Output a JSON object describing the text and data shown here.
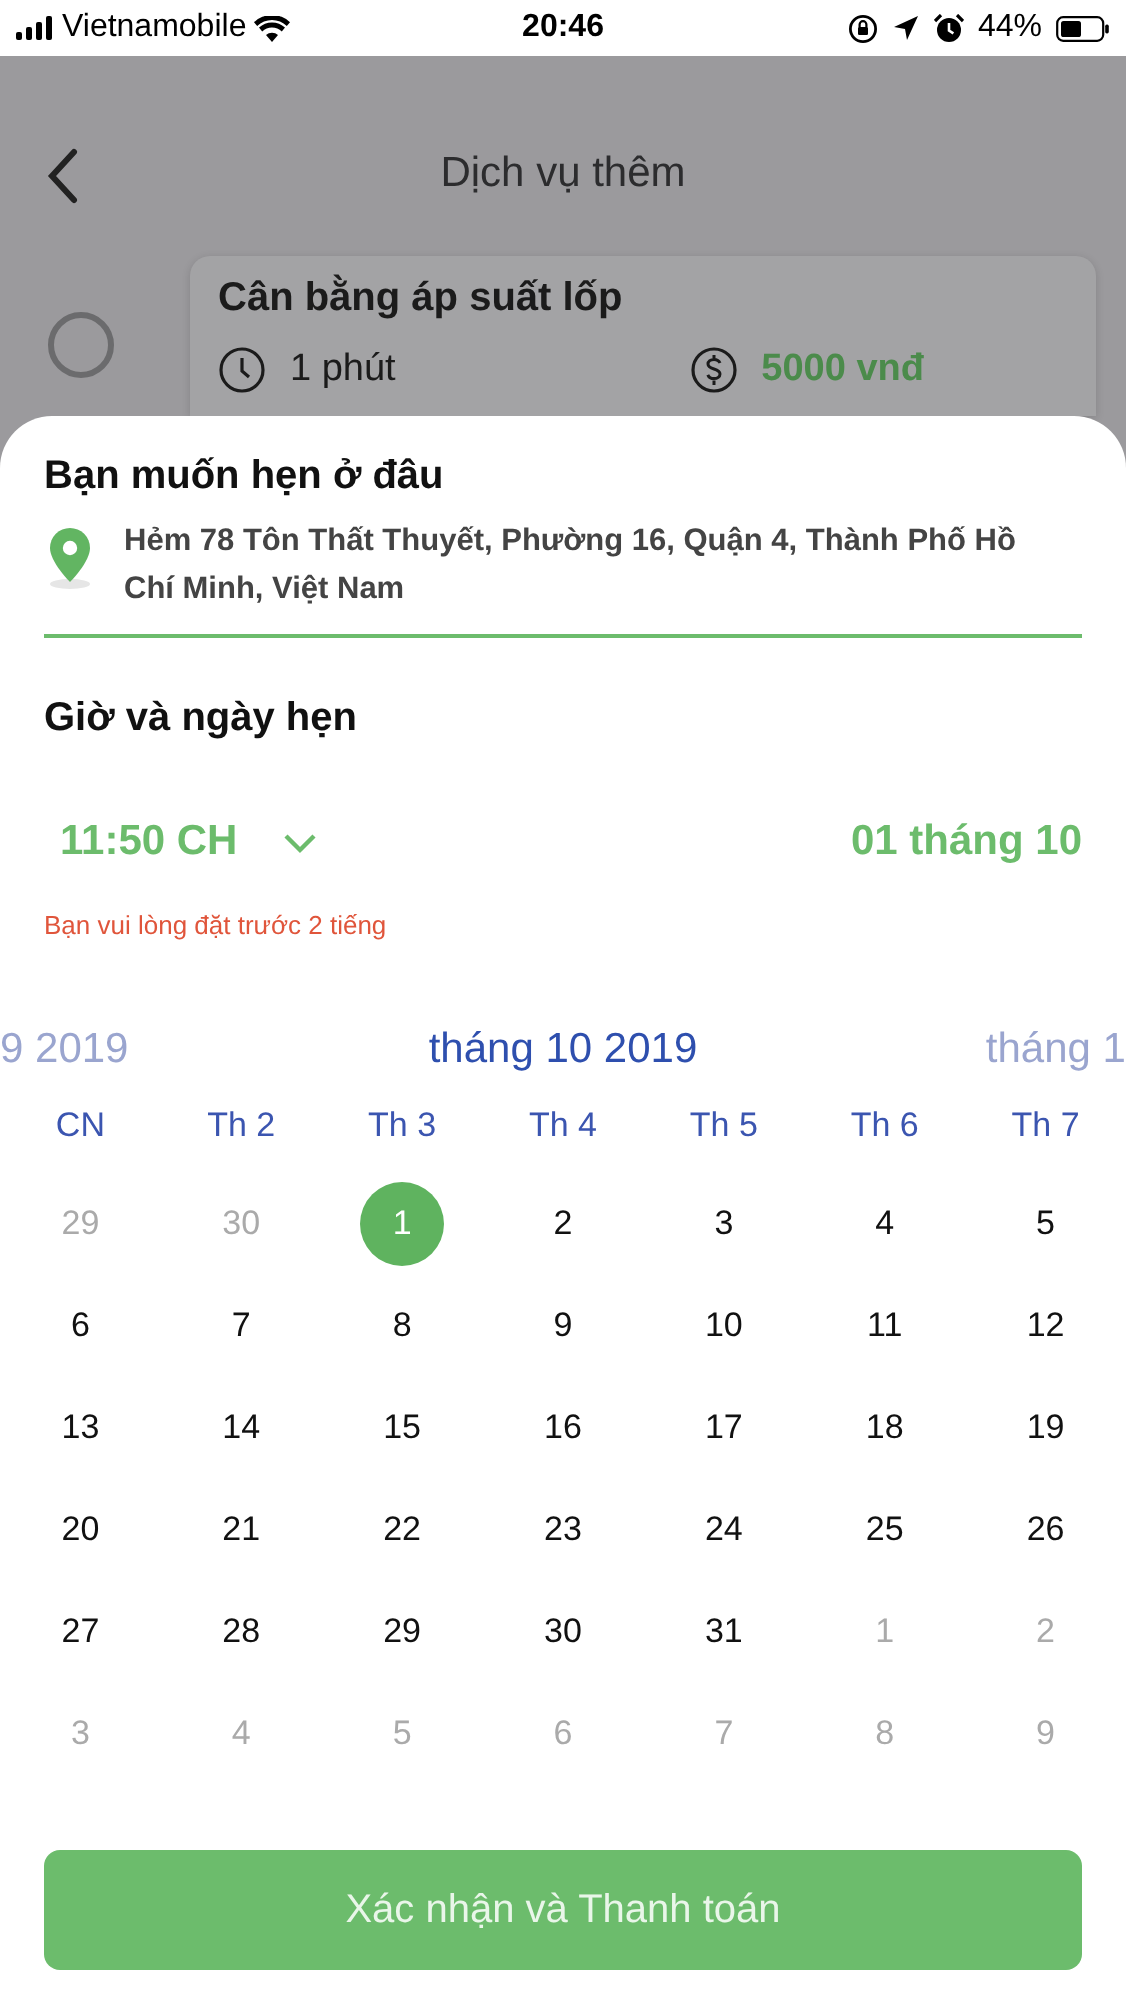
{
  "status_bar": {
    "carrier": "Vietnamobile",
    "time": "20:46",
    "battery": "44%"
  },
  "background_screen": {
    "title": "Dịch vụ thêm",
    "service": {
      "name": "Cân bằng áp suất lốp",
      "duration": "1 phút",
      "price": "5000 vnđ",
      "selected": false
    }
  },
  "sheet": {
    "location_heading": "Bạn muốn hẹn ở đâu",
    "address": "Hẻm 78 Tôn Thất Thuyết, Phường 16, Quận 4, Thành Phố Hồ Chí Minh, Việt Nam",
    "time_heading": "Giờ và ngày hẹn",
    "time": "11:50 CH",
    "date": "01 tháng 10",
    "warning": "Bạn vui lòng đặt trước 2 tiếng",
    "calendar": {
      "months": [
        {
          "label": "9 2019",
          "selected": false
        },
        {
          "label": "tháng 10 2019",
          "selected": true
        },
        {
          "label": "tháng 1",
          "selected": false
        }
      ],
      "weekdays": [
        "CN",
        "Th 2",
        "Th 3",
        "Th 4",
        "Th 5",
        "Th 6",
        "Th 7"
      ],
      "days": [
        {
          "label": "29",
          "outside": true,
          "selected": false
        },
        {
          "label": "30",
          "outside": true,
          "selected": false
        },
        {
          "label": "1",
          "outside": false,
          "selected": true
        },
        {
          "label": "2",
          "outside": false,
          "selected": false
        },
        {
          "label": "3",
          "outside": false,
          "selected": false
        },
        {
          "label": "4",
          "outside": false,
          "selected": false
        },
        {
          "label": "5",
          "outside": false,
          "selected": false
        },
        {
          "label": "6",
          "outside": false,
          "selected": false
        },
        {
          "label": "7",
          "outside": false,
          "selected": false
        },
        {
          "label": "8",
          "outside": false,
          "selected": false
        },
        {
          "label": "9",
          "outside": false,
          "selected": false
        },
        {
          "label": "10",
          "outside": false,
          "selected": false
        },
        {
          "label": "11",
          "outside": false,
          "selected": false
        },
        {
          "label": "12",
          "outside": false,
          "selected": false
        },
        {
          "label": "13",
          "outside": false,
          "selected": false
        },
        {
          "label": "14",
          "outside": false,
          "selected": false
        },
        {
          "label": "15",
          "outside": false,
          "selected": false
        },
        {
          "label": "16",
          "outside": false,
          "selected": false
        },
        {
          "label": "17",
          "outside": false,
          "selected": false
        },
        {
          "label": "18",
          "outside": false,
          "selected": false
        },
        {
          "label": "19",
          "outside": false,
          "selected": false
        },
        {
          "label": "20",
          "outside": false,
          "selected": false
        },
        {
          "label": "21",
          "outside": false,
          "selected": false
        },
        {
          "label": "22",
          "outside": false,
          "selected": false
        },
        {
          "label": "23",
          "outside": false,
          "selected": false
        },
        {
          "label": "24",
          "outside": false,
          "selected": false
        },
        {
          "label": "25",
          "outside": false,
          "selected": false
        },
        {
          "label": "26",
          "outside": false,
          "selected": false
        },
        {
          "label": "27",
          "outside": false,
          "selected": false
        },
        {
          "label": "28",
          "outside": false,
          "selected": false
        },
        {
          "label": "29",
          "outside": false,
          "selected": false
        },
        {
          "label": "30",
          "outside": false,
          "selected": false
        },
        {
          "label": "31",
          "outside": false,
          "selected": false
        },
        {
          "label": "1",
          "outside": true,
          "selected": false
        },
        {
          "label": "2",
          "outside": true,
          "selected": false
        },
        {
          "label": "3",
          "outside": true,
          "selected": false
        },
        {
          "label": "4",
          "outside": true,
          "selected": false
        },
        {
          "label": "5",
          "outside": true,
          "selected": false
        },
        {
          "label": "6",
          "outside": true,
          "selected": false
        },
        {
          "label": "7",
          "outside": true,
          "selected": false
        },
        {
          "label": "8",
          "outside": true,
          "selected": false
        },
        {
          "label": "9",
          "outside": true,
          "selected": false
        }
      ]
    },
    "confirm_button": "Xác nhận và Thanh toán"
  }
}
